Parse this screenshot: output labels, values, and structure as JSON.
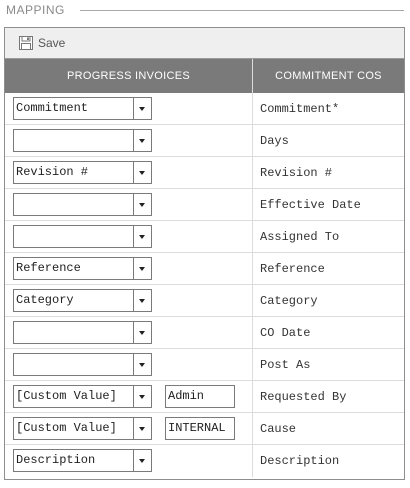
{
  "section": {
    "title": "MAPPING"
  },
  "toolbar": {
    "save_label": "Save",
    "save_icon": "floppy-disk-icon"
  },
  "table": {
    "headers": {
      "left": "PROGRESS INVOICES",
      "right": "COMMITMENT COS"
    },
    "rows": [
      {
        "select": "Commitment",
        "custom": null,
        "target": "Commitment*"
      },
      {
        "select": "",
        "custom": null,
        "target": "Days"
      },
      {
        "select": "Revision #",
        "custom": null,
        "target": "Revision #"
      },
      {
        "select": "",
        "custom": null,
        "target": "Effective Date"
      },
      {
        "select": "",
        "custom": null,
        "target": "Assigned To"
      },
      {
        "select": "Reference",
        "custom": null,
        "target": "Reference"
      },
      {
        "select": "Category",
        "custom": null,
        "target": "Category"
      },
      {
        "select": "",
        "custom": null,
        "target": "CO Date"
      },
      {
        "select": "",
        "custom": null,
        "target": "Post As"
      },
      {
        "select": "[Custom Value]",
        "custom": "Admin",
        "target": "Requested By"
      },
      {
        "select": "[Custom Value]",
        "custom": "INTERNAL",
        "target": "Cause"
      },
      {
        "select": "Description",
        "custom": null,
        "target": "Description"
      }
    ]
  },
  "colors": {
    "header_bg": "#7a7a7a",
    "toolbar_bg": "#efefef",
    "border": "#8e8e8e"
  }
}
